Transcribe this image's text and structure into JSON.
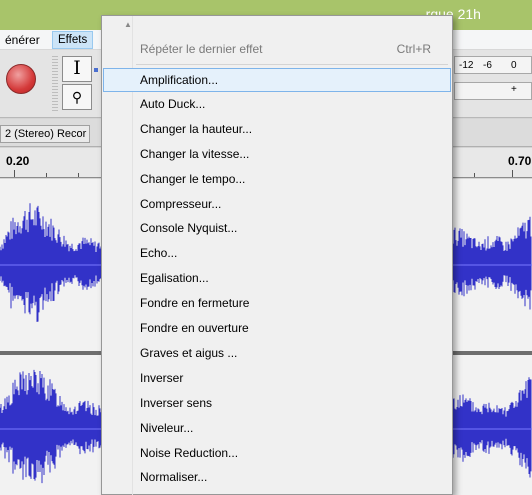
{
  "window": {
    "title": "...rque 21h"
  },
  "menubar": {
    "items": [
      {
        "label": "énérer"
      },
      {
        "label": "Effets"
      }
    ]
  },
  "toolbar": {
    "meter_labels": [
      "-12",
      "-6",
      "0"
    ]
  },
  "track": {
    "name": "2 (Stereo) Recor"
  },
  "ruler": {
    "labels": [
      "0.20",
      "0.70"
    ]
  },
  "menu": {
    "repeat_label": "Répéter le dernier effet",
    "repeat_shortcut": "Ctrl+R",
    "items": [
      "Amplification...",
      "Auto Duck...",
      "Changer la hauteur...",
      "Changer la vitesse...",
      "Changer le tempo...",
      "Compresseur...",
      "Console Nyquist...",
      "Echo...",
      "Egalisation...",
      "Fondre en fermeture",
      "Fondre en ouverture",
      "Graves et aigus ...",
      "Inverser",
      "Inverser sens",
      "Niveleur...",
      "Noise Reduction...",
      "Normaliser..."
    ]
  },
  "colors": {
    "titlebar": "#a8c46a",
    "waveform": "#3232c8",
    "highlight": "#e5f1fb"
  }
}
